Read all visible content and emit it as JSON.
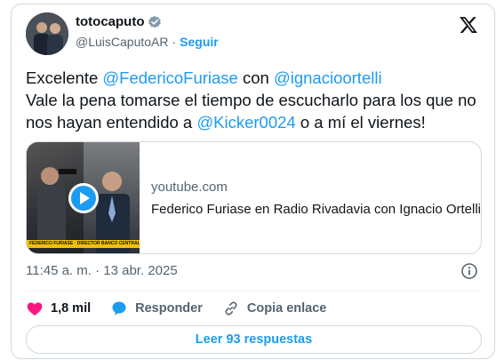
{
  "author": {
    "display_name": "totocaputo",
    "handle": "@LuisCaputoAR",
    "follow_label": "Seguir"
  },
  "tweet": {
    "text_segments": [
      {
        "t": "Excelente ",
        "mention": false
      },
      {
        "t": "@FedericoFuriase",
        "mention": true
      },
      {
        "t": " con ",
        "mention": false
      },
      {
        "t": "@ignacioortelli",
        "mention": true
      },
      {
        "t": "\nVale la pena tomarse el tiempo de escucharlo para los que no nos hayan entendido a ",
        "mention": false
      },
      {
        "t": "@Kicker0024",
        "mention": true
      },
      {
        "t": " o a mí el viernes!",
        "mention": false
      }
    ]
  },
  "link_card": {
    "domain": "youtube.com",
    "title": "Federico Furiase en Radio Rivadavia con Ignacio Ortelli",
    "thumbnail_caption": "FEDERICO FURIASE · DIRECTOR BANCO CENTRAL"
  },
  "timestamp": "11:45 a. m. · 13 abr. 2025",
  "actions": {
    "likes": "1,8 mil",
    "reply_label": "Responder",
    "copy_link_label": "Copia enlace"
  },
  "replies_button": "Leer 93 respuestas",
  "colors": {
    "accent": "#1d9bf0",
    "like": "#f91880",
    "text": "#0f1419",
    "muted": "#536471"
  },
  "icons": [
    "verified-badge-icon",
    "x-logo-icon",
    "play-icon",
    "info-icon",
    "heart-icon",
    "reply-bubble-icon",
    "link-icon"
  ]
}
